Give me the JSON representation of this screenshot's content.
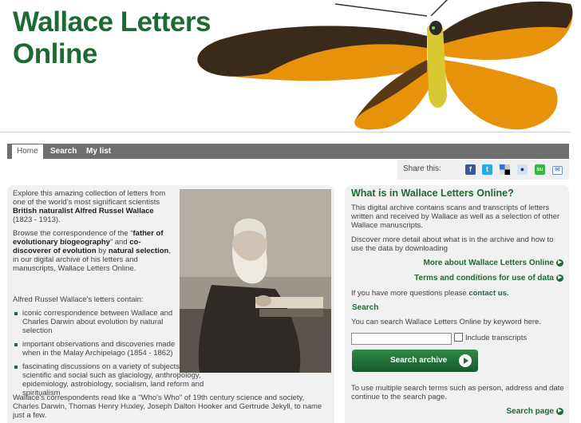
{
  "header": {
    "title_line1": "Wallace Letters",
    "title_line2": "Online"
  },
  "nav": [
    {
      "label": "Home",
      "active": true
    },
    {
      "label": "Search",
      "active": false
    },
    {
      "label": "My list",
      "active": false
    }
  ],
  "share": {
    "label": "Share this:",
    "icons": [
      "facebook-icon",
      "twitter-icon",
      "delicious-icon",
      "reddit-icon",
      "stumbleupon-icon",
      "email-icon"
    ]
  },
  "intro": {
    "p1_pre": "Explore this amazing collection of letters from one of the world’s most significant scientists ",
    "p1_bold": "British naturalist Alfred Russel Wallace",
    "p1_post": " (1823 - 1913).",
    "p2_a": "Browse the correspondence of the “",
    "p2_b": "father of evolutionary biogeography",
    "p2_c": "” and ",
    "p2_d": "co-discoverer of evolution",
    "p2_e": " by ",
    "p2_f": "natural selection",
    "p2_g": ", in our digital archive of his letters and manuscripts, Wallace Letters Online.",
    "list_label": "Alfred Russel Wallace's letters contain:",
    "list": [
      "iconic correspondence between Wallace and Charles Darwin about evolution by natural selection",
      "important observations and discoveries made when in the Malay Archipelago (1854 - 1862)",
      "fascinating discussions on a variety of subjects, scientific and social such as glaciology, anthropology, epidemiology, astrobiology, socialism, land reform and spiritualism"
    ],
    "bottom": "Wallace's correspondents read like a \"Who's Who\" of 19th century science and society, Charles Darwin, Thomas Henry Huxley, Joseph Dalton Hooker and Gertrude Jekyll, to name just a few."
  },
  "right": {
    "title": "What is in Wallace Letters Online?",
    "p1": "This digital archive contains scans and transcripts of letters written and received by Wallace as well as a selection of other Wallace manuscripts.",
    "p2": "Discover more detail about what is in the archive and how to use the data by downloading",
    "link_more": "More about Wallace Letters Online",
    "link_terms": "Terms and conditions for use of data",
    "contact_pre": "If you have more questions please ",
    "contact_link": "contact us.",
    "search_heading": "Search",
    "search_desc": "You can search Wallace Letters Online by keyword here.",
    "search_value": "",
    "include_label": "Include transcripts",
    "button_label": "Search archive",
    "multi": "To use multiple search terms such as person, address and date continue to the search page.",
    "search_page_link": "Search page"
  },
  "colors": {
    "brand_green": "#1d6b32",
    "nav_bg": "#6e6e6e",
    "panel_bg": "#f1f1f1"
  }
}
